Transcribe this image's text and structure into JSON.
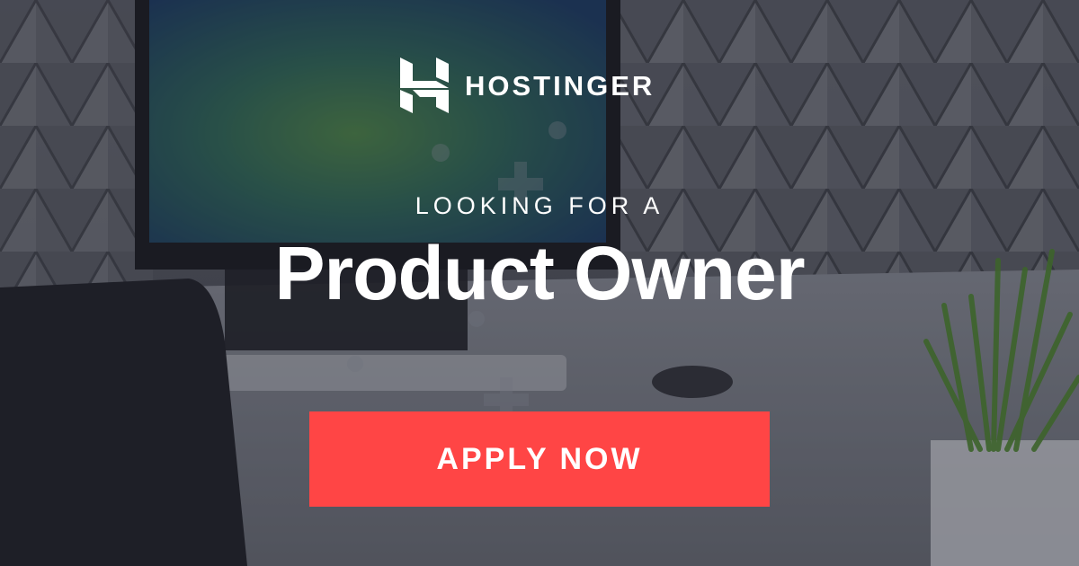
{
  "brand": {
    "name": "HOSTINGER",
    "logo_icon": "hostinger-h-logo-icon"
  },
  "eyebrow": "LOOKING FOR A",
  "headline": "Product Owner",
  "cta_label": "APPLY NOW",
  "colors": {
    "cta_background": "#ff4545",
    "text": "#ffffff",
    "overlay": "#1c1e28"
  }
}
